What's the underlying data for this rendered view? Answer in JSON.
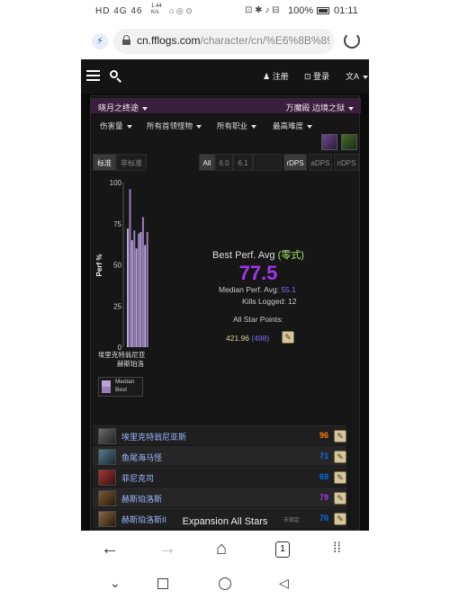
{
  "status_bar": {
    "left_text": "HD  4G 46 ",
    "speed": "1.44\nK/s",
    "battery": "100%",
    "time": "01:11"
  },
  "address_bar": {
    "url_host": "cn.fflogs.com",
    "url_path": "/character/cn/%E6%8B%89%E6"
  },
  "site_nav": {
    "register": "注册",
    "login": "登录",
    "language": "文A"
  },
  "filters": {
    "zone": "晓月之终途",
    "raid": "万魔殿 边境之狱",
    "metric": "伤害量",
    "bosses": "所有首领怪物",
    "jobs": "所有职业",
    "difficulty": "最高难度"
  },
  "tabs": {
    "standard": "标准",
    "non_standard": "非标准",
    "all": "All",
    "p60": "6.0",
    "p61": "6.1",
    "rdps": "rDPS",
    "adps": "aDPS",
    "ndps": "nDPS"
  },
  "chart_data": {
    "type": "bar",
    "ylabel": "Perf %",
    "ylim": [
      0,
      100
    ],
    "yticks": [
      "100",
      "75",
      "50",
      "25",
      "0"
    ],
    "categories": [
      "埃里克特翁尼亚斯",
      "鱼尾海马怪",
      "菲尼克司",
      "赫斯珀洛斯",
      "赫斯珀洛斯II"
    ],
    "xtick_label": "埃里克特翁尼亚赫斯珀洛",
    "series": [
      {
        "name": "Median",
        "values": [
          72,
          65,
          60,
          70,
          62
        ]
      },
      {
        "name": "Best",
        "values": [
          96,
          71,
          69,
          79,
          70
        ]
      }
    ],
    "legend": [
      "Median",
      "Best"
    ]
  },
  "summary": {
    "title": "Best Perf. Avg",
    "title_tag": "(零式)",
    "value": "77.5",
    "median_label": "Median Perf. Avg:",
    "median_value": "55.1",
    "kills_label": "Kills Logged:",
    "kills_value": "12",
    "allstar_label": "All Star Points:",
    "allstar_points": "421.96",
    "allstar_rank": "(498)"
  },
  "bosses": [
    {
      "name": "埃里克特翁尼亚斯",
      "pct": "96",
      "color": "#ff8000",
      "tag": ""
    },
    {
      "name": "鱼尾海马怪",
      "pct": "71",
      "color": "#0070ff",
      "tag": ""
    },
    {
      "name": "菲尼克司",
      "pct": "69",
      "color": "#0070ff",
      "tag": ""
    },
    {
      "name": "赫斯珀洛斯",
      "pct": "79",
      "color": "#a335ee",
      "tag": ""
    },
    {
      "name": "赫斯珀洛斯II",
      "pct": "70",
      "color": "#0070ff",
      "tag": "未锁定"
    }
  ],
  "expansion": "Expansion All Stars"
}
